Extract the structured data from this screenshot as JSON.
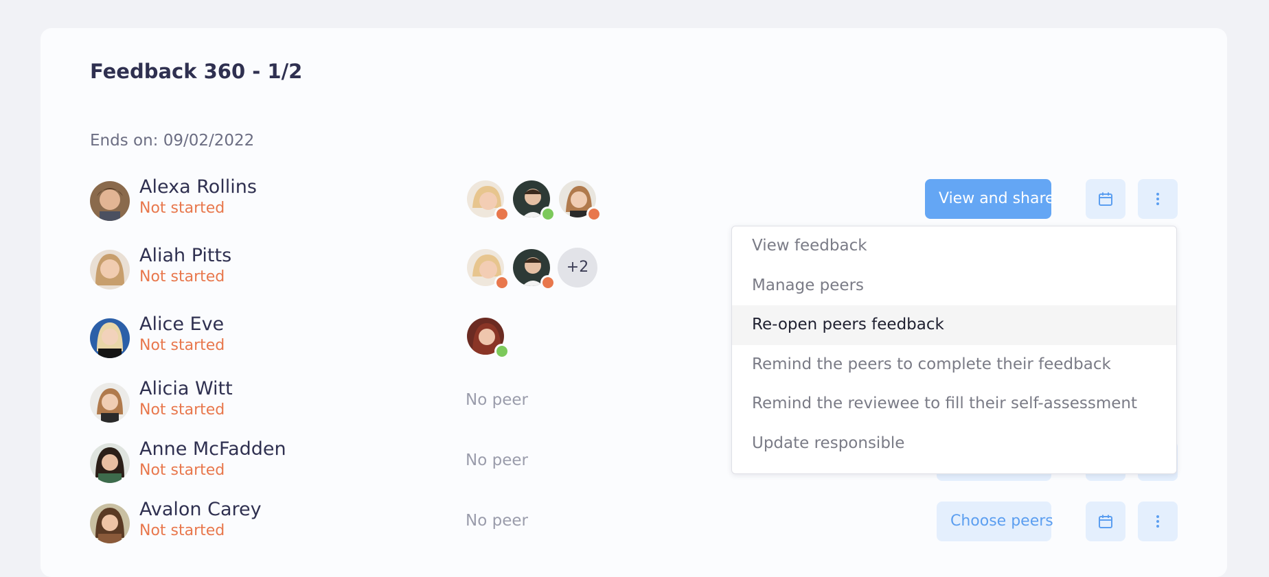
{
  "page": {
    "title": "Feedback 360 - 1/2",
    "ends_on": "Ends on: 09/02/2022"
  },
  "colors": {
    "accent": "#64a6f4",
    "status_not_started": "#e8774c",
    "peer_done": "#7cc95b",
    "peer_pending": "#e8774c"
  },
  "rows": [
    {
      "name": "Alexa Rollins",
      "status": "Not started",
      "peers": [
        "pending",
        "done",
        "pending"
      ],
      "primary_action": "View and share"
    },
    {
      "name": "Aliah Pitts",
      "status": "Not started",
      "peers": [
        "pending",
        "pending"
      ],
      "more_peers": "+2"
    },
    {
      "name": "Alice Eve",
      "status": "Not started",
      "peers": [
        "done"
      ]
    },
    {
      "name": "Alicia Witt",
      "status": "Not started",
      "no_peer": "No peer"
    },
    {
      "name": "Anne McFadden",
      "status": "Not started",
      "no_peer": "No peer"
    },
    {
      "name": "Avalon Carey",
      "status": "Not started",
      "no_peer": "No peer",
      "primary_action": "Choose peers"
    }
  ],
  "actions_menu": {
    "items": [
      "View feedback",
      "Manage peers",
      "Re-open peers feedback",
      "Remind the peers to complete their feedback",
      "Remind the reviewee to fill their self-assessment",
      "Update responsible"
    ],
    "highlighted_index": 2
  },
  "icons": {
    "schedule": "calendar-icon",
    "more": "more-vertical-icon"
  }
}
